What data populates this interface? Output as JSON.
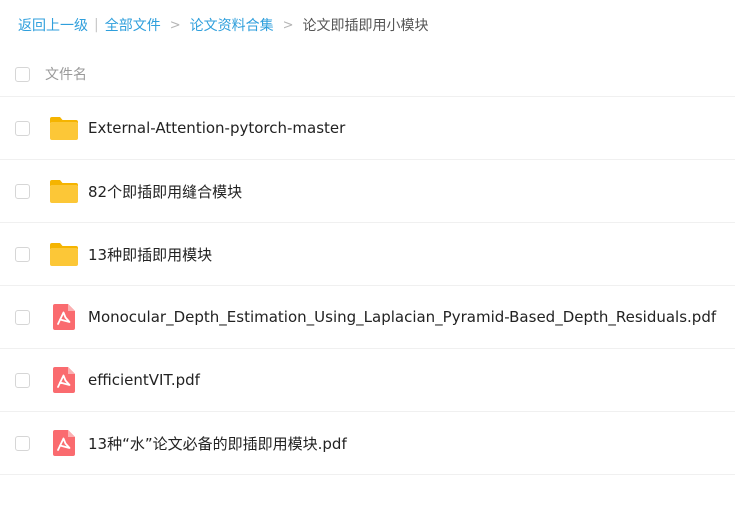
{
  "breadcrumb": {
    "back": "返回上一级",
    "all_files": "全部文件",
    "folder1": "论文资料合集",
    "current": "论文即插即用小模块",
    "bar": "|",
    "sep": ">"
  },
  "list_header": {
    "name_label": "文件名"
  },
  "files": [
    {
      "name": "External-Attention-pytorch-master",
      "type": "folder-icon"
    },
    {
      "name": "82个即插即用缝合模块",
      "type": "folder-icon"
    },
    {
      "name": "13种即插即用模块",
      "type": "folder-icon"
    },
    {
      "name": "Monocular_Depth_Estimation_Using_Laplacian_Pyramid-Based_Depth_Residuals.pdf",
      "type": "pdf-icon"
    },
    {
      "name": "efficientVIT.pdf",
      "type": "pdf-icon"
    },
    {
      "name": "13种“水”论文必备的即插即用模块.pdf",
      "type": "pdf-icon"
    }
  ],
  "colors": {
    "link": "#2f9fdc",
    "folder": "#fcc737",
    "pdf": "#fa6b6f"
  }
}
